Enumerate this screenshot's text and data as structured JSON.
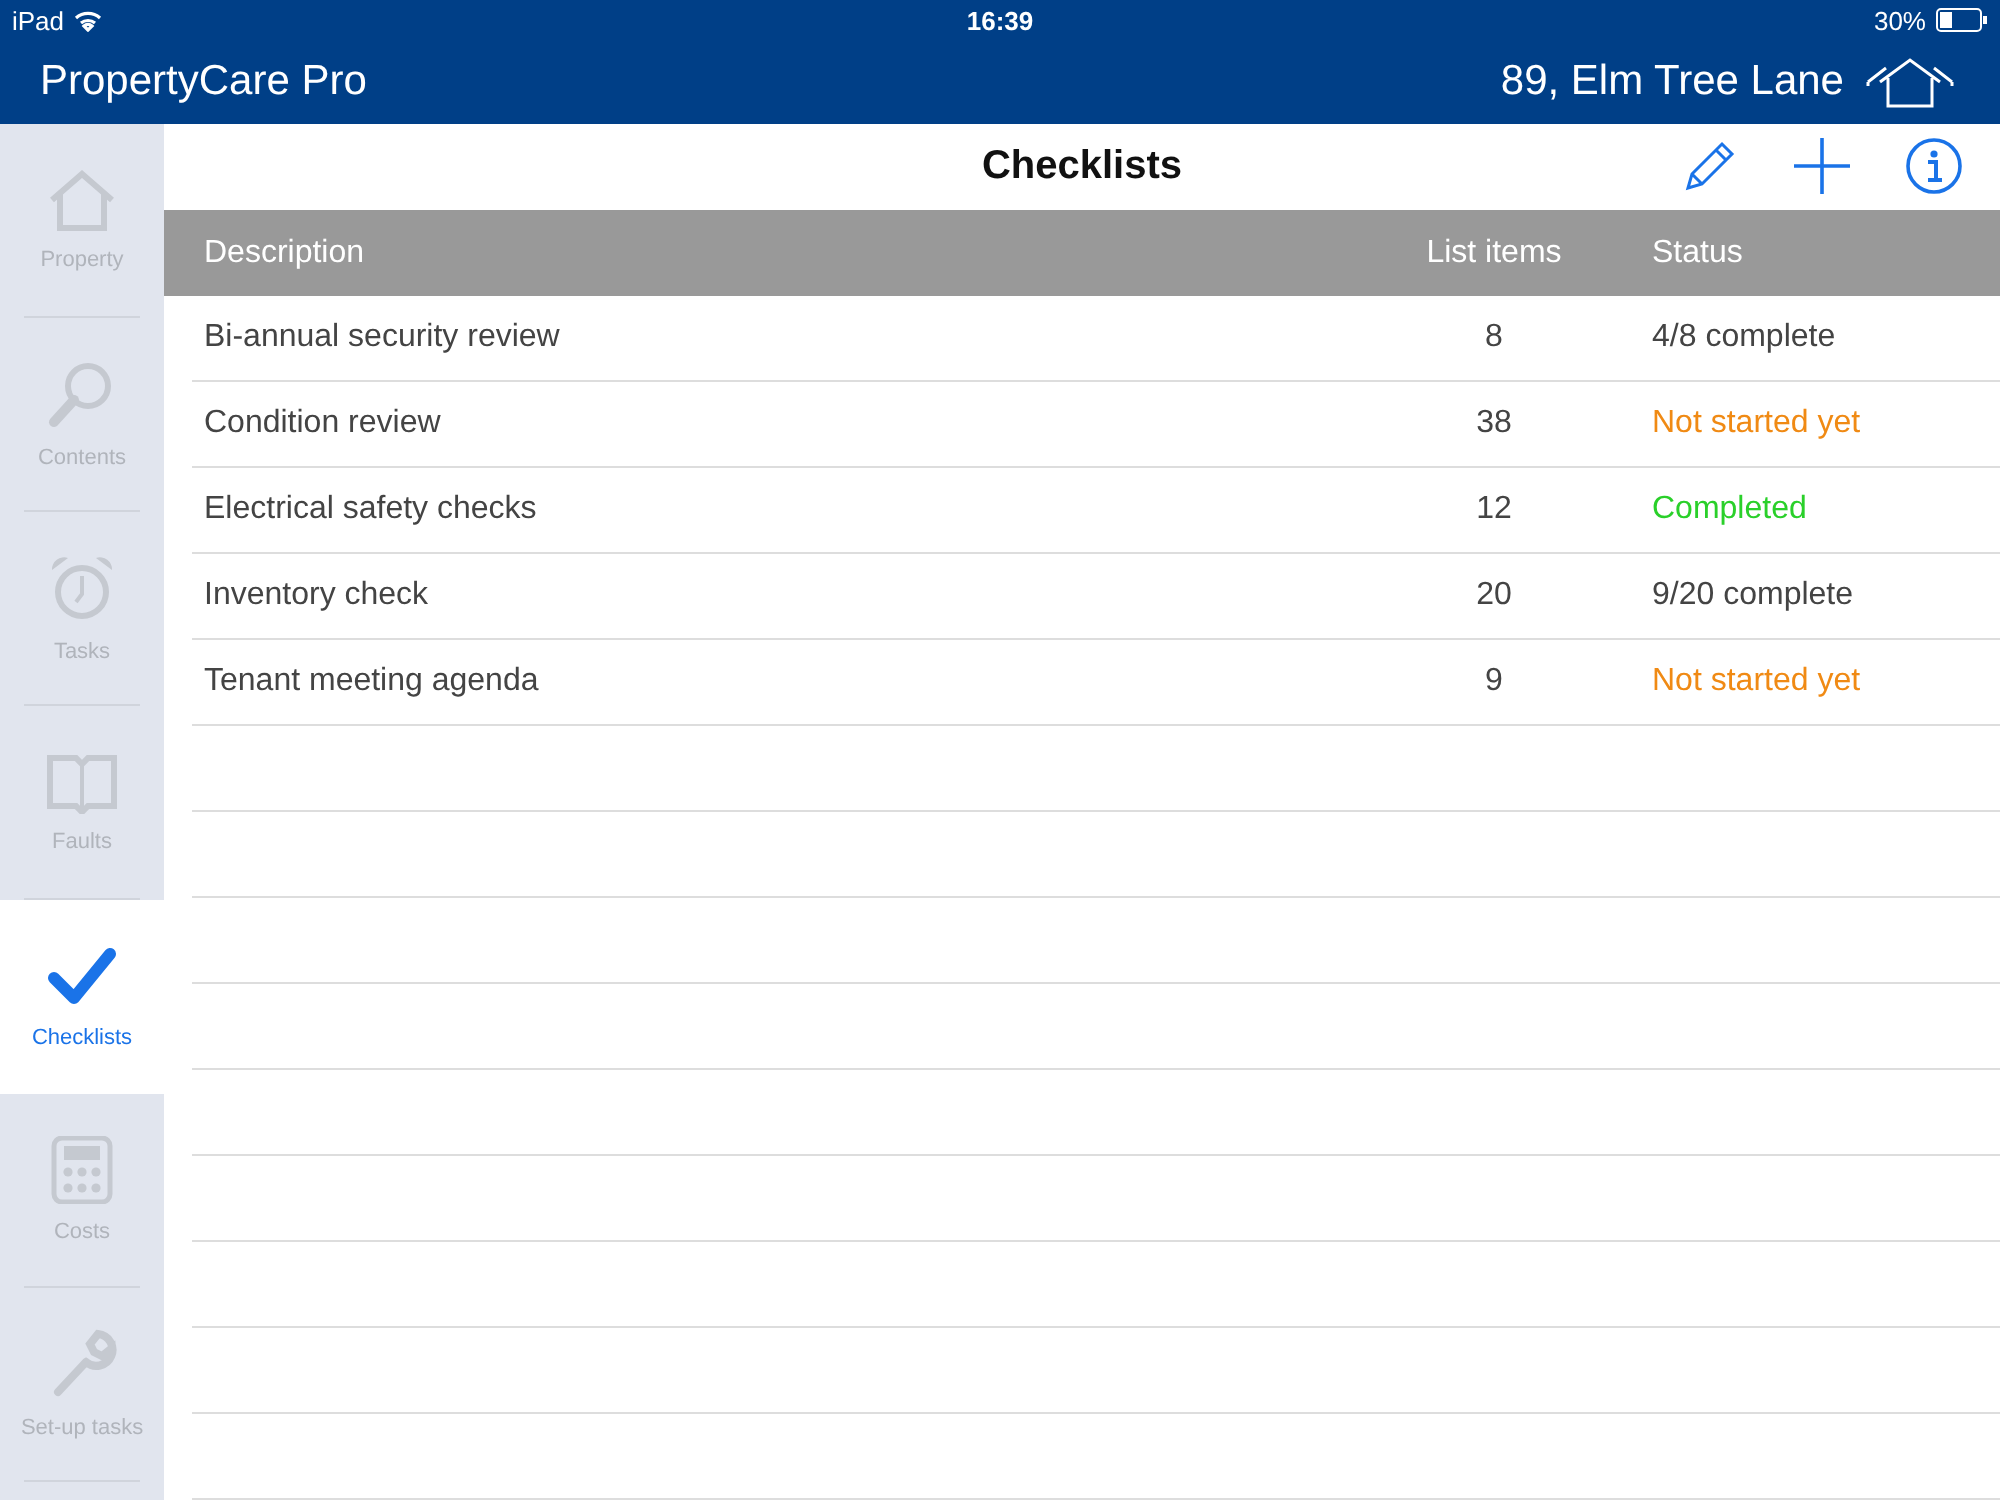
{
  "status_bar": {
    "device": "iPad",
    "time": "16:39",
    "battery": "30%"
  },
  "app_header": {
    "title": "PropertyCare Pro",
    "property": "89, Elm Tree Lane"
  },
  "sidebar": {
    "items": [
      {
        "label": "Property",
        "selected": false
      },
      {
        "label": "Contents",
        "selected": false
      },
      {
        "label": "Tasks",
        "selected": false
      },
      {
        "label": "Faults",
        "selected": false
      },
      {
        "label": "Checklists",
        "selected": true
      },
      {
        "label": "Costs",
        "selected": false
      },
      {
        "label": "Set-up tasks",
        "selected": false
      }
    ]
  },
  "page": {
    "title": "Checklists"
  },
  "table": {
    "columns": [
      "Description",
      "List items",
      "Status"
    ],
    "rows": [
      {
        "description": "Bi-annual security review",
        "items": "8",
        "status": "4/8 complete",
        "kind": "progress"
      },
      {
        "description": "Condition review",
        "items": "38",
        "status": "Not started yet",
        "kind": "not_started"
      },
      {
        "description": "Electrical safety checks",
        "items": "12",
        "status": "Completed",
        "kind": "completed"
      },
      {
        "description": "Inventory check",
        "items": "20",
        "status": "9/20 complete",
        "kind": "progress"
      },
      {
        "description": "Tenant meeting agenda",
        "items": "9",
        "status": "Not started yet",
        "kind": "not_started"
      }
    ]
  }
}
